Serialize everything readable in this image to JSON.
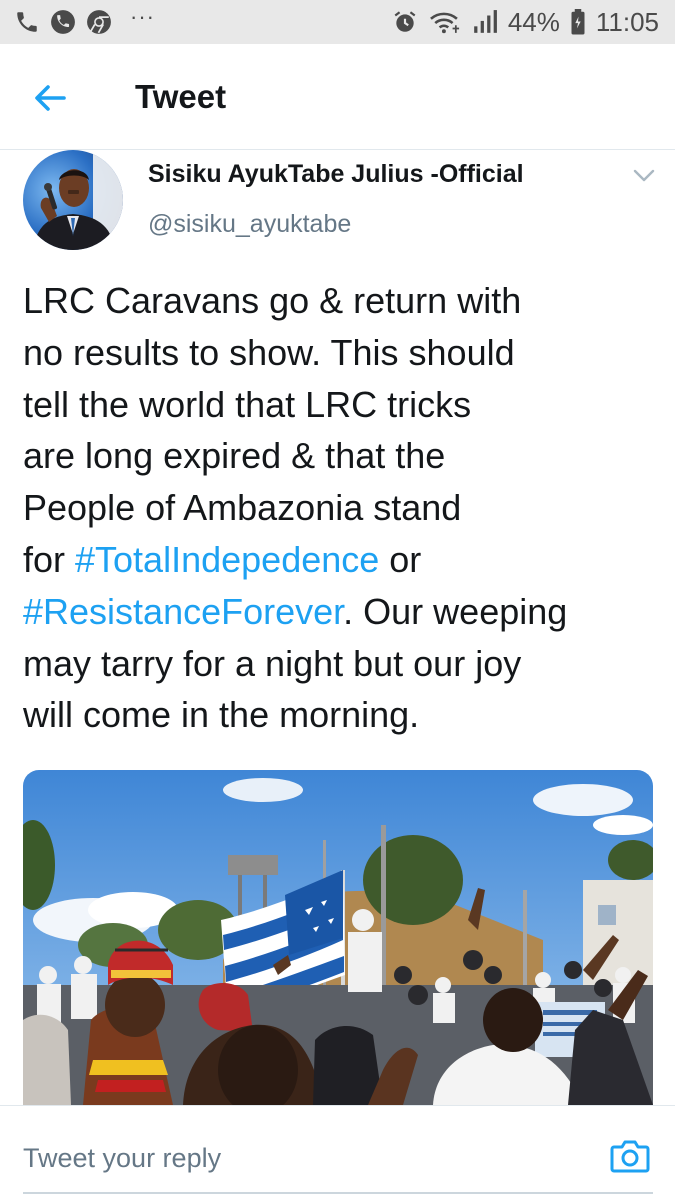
{
  "status_bar": {
    "battery": "44%",
    "time": "11:05",
    "icons_left": [
      "phone-icon",
      "phone-call-icon",
      "chrome-icon",
      "more-dots-icon"
    ],
    "icons_right": [
      "alarm-icon",
      "wifi-icon",
      "signal-icon",
      "battery-icon"
    ]
  },
  "header": {
    "title": "Tweet",
    "back_icon": "back-arrow-icon"
  },
  "tweet": {
    "author_name": "Sisiku AyukTabe Julius -Official",
    "author_handle": "@sisiku_ayuktabe",
    "lines": [
      "LRC Caravans go & return with",
      "no results to show. This should",
      "tell the world that LRC tricks",
      "are long expired & that the",
      "People of Ambazonia stand"
    ],
    "line6_prefix": "for ",
    "hashtag1": "#TotalIndepedence",
    "line6_suffix": " or",
    "hashtag2": "#ResistanceForever",
    "line7_suffix": ". Our weeping",
    "line8": "may tarry for a night but our joy",
    "line9": "will come in the morning."
  },
  "reply": {
    "placeholder": "Tweet your reply",
    "camera_icon": "camera-icon"
  },
  "colors": {
    "accent": "#1da1f2",
    "text": "#14171a",
    "secondary": "#657786",
    "statusbar": "#e8e8e8"
  }
}
